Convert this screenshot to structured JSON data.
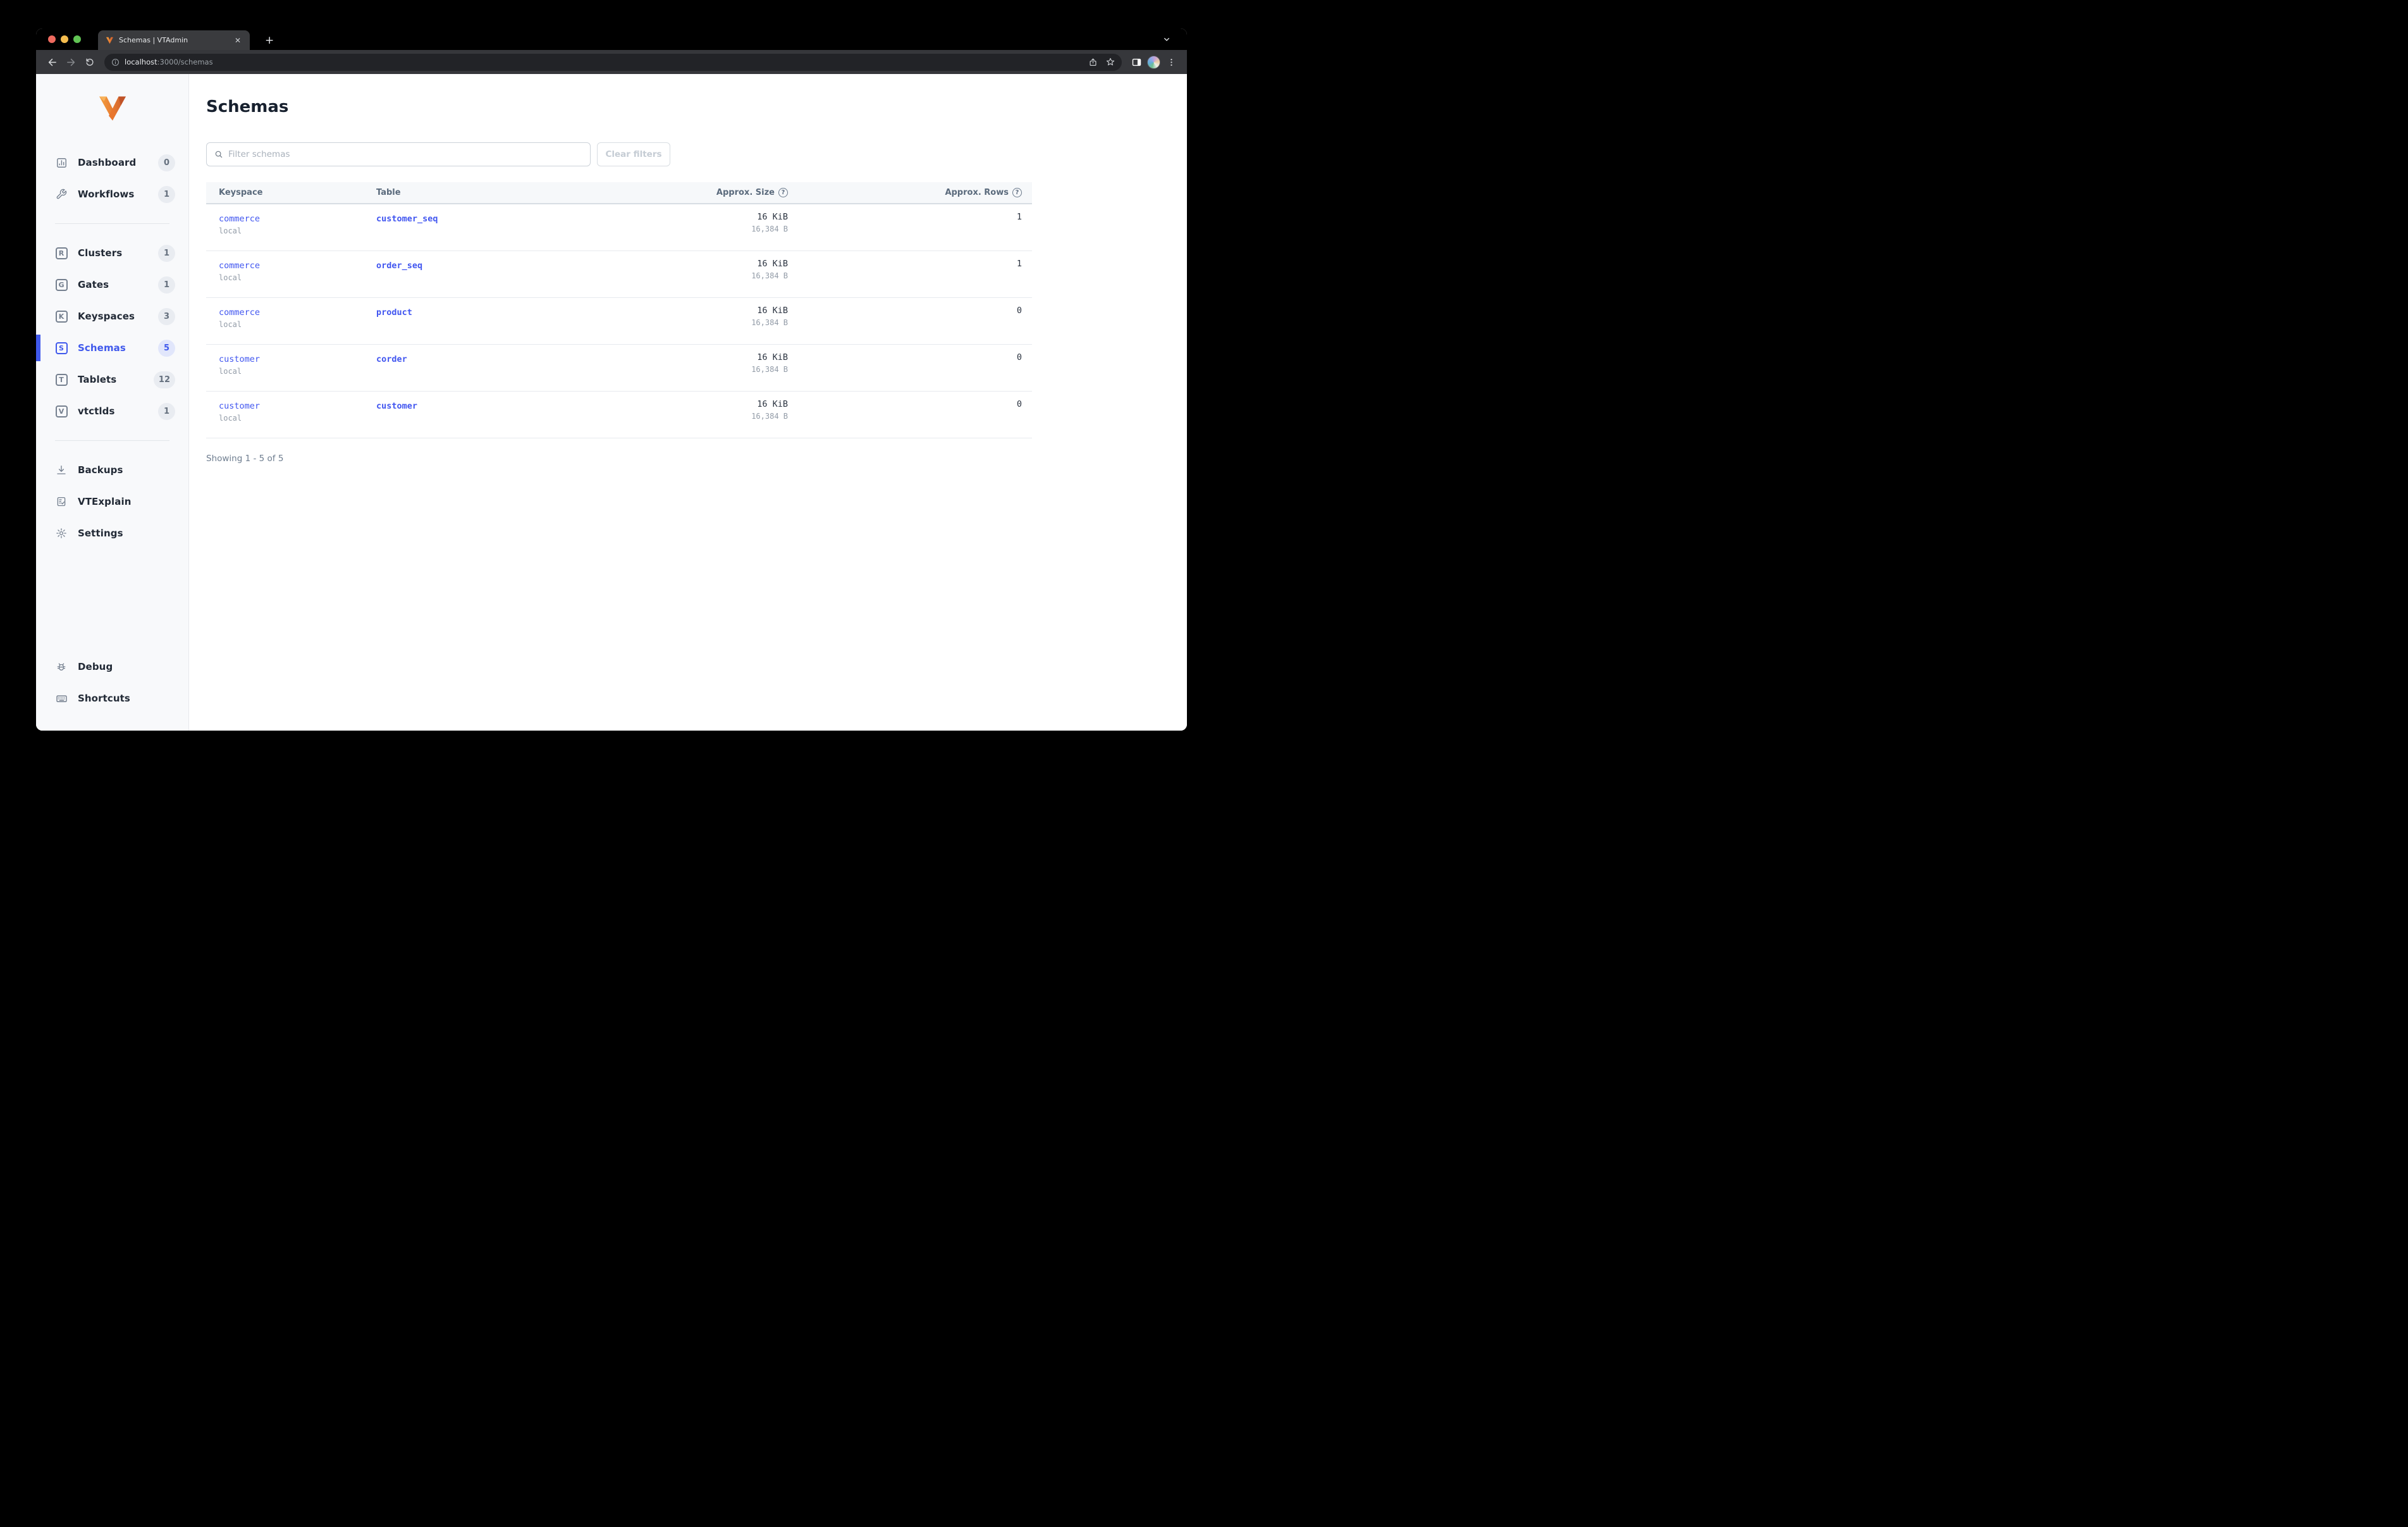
{
  "browser": {
    "tab_title": "Schemas | VTAdmin",
    "close_tab_glyph": "✕",
    "new_tab_glyph": "+",
    "url_host": "localhost",
    "url_path": ":3000/schemas"
  },
  "sidebar": {
    "items": [
      {
        "label": "Dashboard",
        "badge": "0"
      },
      {
        "label": "Workflows",
        "badge": "1"
      },
      {
        "label": "Clusters",
        "badge": "1",
        "letter": "R"
      },
      {
        "label": "Gates",
        "badge": "1",
        "letter": "G"
      },
      {
        "label": "Keyspaces",
        "badge": "3",
        "letter": "K"
      },
      {
        "label": "Schemas",
        "badge": "5",
        "letter": "S"
      },
      {
        "label": "Tablets",
        "badge": "12",
        "letter": "T"
      },
      {
        "label": "vtctlds",
        "badge": "1",
        "letter": "V"
      },
      {
        "label": "Backups"
      },
      {
        "label": "VTExplain"
      },
      {
        "label": "Settings"
      },
      {
        "label": "Debug"
      },
      {
        "label": "Shortcuts"
      }
    ]
  },
  "main": {
    "title": "Schemas",
    "filter_placeholder": "Filter schemas",
    "clear_filters_label": "Clear filters",
    "footer": "Showing 1 - 5 of 5",
    "table": {
      "headers": [
        "Keyspace",
        "Table",
        "Approx. Size",
        "Approx. Rows"
      ],
      "help_glyph": "?",
      "rows": [
        {
          "keyspace": "commerce",
          "cluster": "local",
          "table": "customer_seq",
          "size": "16 KiB",
          "size_bytes": "16,384 B",
          "rows": "1"
        },
        {
          "keyspace": "commerce",
          "cluster": "local",
          "table": "order_seq",
          "size": "16 KiB",
          "size_bytes": "16,384 B",
          "rows": "1"
        },
        {
          "keyspace": "commerce",
          "cluster": "local",
          "table": "product",
          "size": "16 KiB",
          "size_bytes": "16,384 B",
          "rows": "0"
        },
        {
          "keyspace": "customer",
          "cluster": "local",
          "table": "corder",
          "size": "16 KiB",
          "size_bytes": "16,384 B",
          "rows": "0"
        },
        {
          "keyspace": "customer",
          "cluster": "local",
          "table": "customer",
          "size": "16 KiB",
          "size_bytes": "16,384 B",
          "rows": "0"
        }
      ]
    }
  },
  "colors": {
    "accent": "#4059ec",
    "link": "#4156f0",
    "sidebar_bg": "#f8f9fb",
    "table_header_bg": "#f6f8fa",
    "toolbar_bg": "#36373b",
    "omnibox_bg": "#222327",
    "tabstrip_bg": "#000000",
    "tab_bg": "#3a3b3e",
    "traffic_red": "#ee6a5f",
    "traffic_yellow": "#f5bd4f",
    "traffic_green": "#61c454",
    "logo_orange_light": "#f5a03c",
    "logo_orange_dark": "#cc5b2d"
  }
}
